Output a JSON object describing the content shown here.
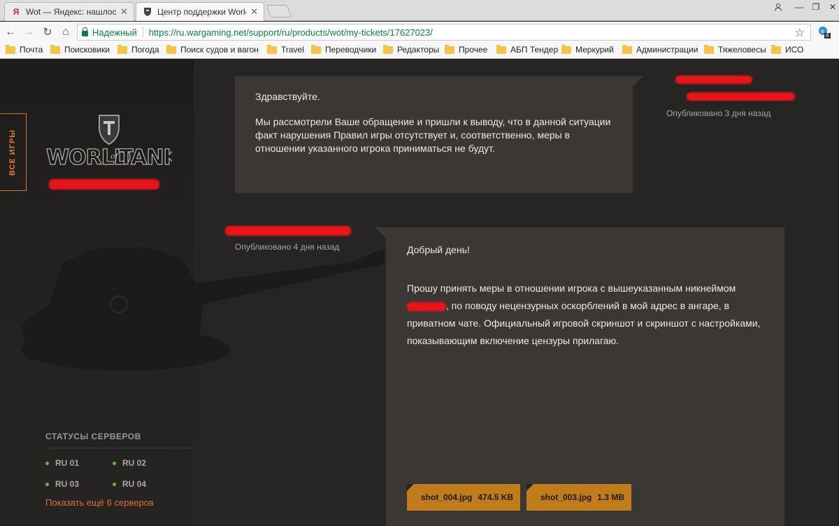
{
  "browser": {
    "tabs": [
      {
        "title": "Wot — Яндекс: нашлось",
        "icon": "yandex-icon"
      },
      {
        "title": "Центр поддержки World",
        "icon": "wot-icon"
      }
    ],
    "security_label": "Надежный",
    "url": "https://ru.wargaming.net/support/ru/products/wot/my-tickets/17627023/",
    "extension_badge": "4",
    "bookmarks": [
      "Почта",
      "Поисковики",
      "Погода",
      "Поиск судов и вагон",
      "Travel",
      "Переводчики",
      "Редакторы",
      "Прочее",
      "АБП Тендер",
      "Меркурий",
      "Администрации",
      "Тяжеловесы",
      "ИСО"
    ]
  },
  "sidebar": {
    "all_games": "ВСЕ ИГРЫ",
    "logo_text": "WORLD of TANKS",
    "servers_title": "СТАТУСЫ СЕРВЕРОВ",
    "servers": [
      "RU 01",
      "RU 02",
      "RU 03",
      "RU 04"
    ],
    "status_color": "#6bb63b",
    "more_servers": "Показать ещё 6 серверов"
  },
  "messages": [
    {
      "greeting": "Здравствуйте.",
      "body": "Мы рассмотрели Ваше обращение и пришли к выводу, что в данной ситуации факт нарушения Правил игры отсутствует и, соответственно, меры в отношении указанного игрока приниматься не будут.",
      "published": "Опубликовано 3 дня назад"
    },
    {
      "greeting": "Добрый день!",
      "body_part1": "Прошу принять меры в отношении игрока с вышеуказанным никнеймом",
      "body_part2": ", по поводу нецензурных оскорблений в мой адрес в ангаре, в приватном чате. Официальный игровой скриншот и скриншот с настройками, показывающим включение цензуры прилагаю.",
      "published": "Опубликовано 4 дня назад",
      "attachments": [
        {
          "name": "shot_004.jpg",
          "size": "474.5 KB"
        },
        {
          "name": "shot_003.jpg",
          "size": "1.3 MB"
        }
      ]
    }
  ],
  "colors": {
    "accent": "#d9822b",
    "attachment": "#c07b1a",
    "secure": "#0b8043"
  }
}
